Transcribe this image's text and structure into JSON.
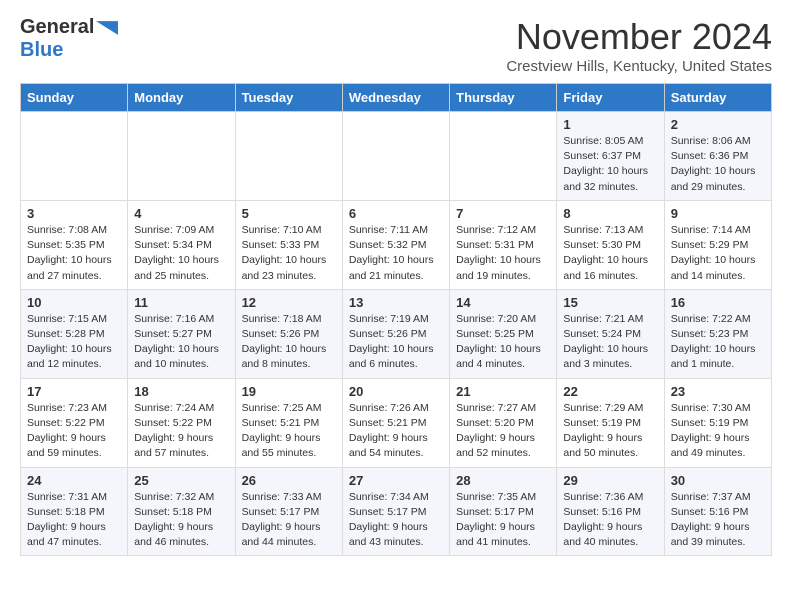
{
  "header": {
    "logo_line1": "General",
    "logo_line2": "Blue",
    "month": "November 2024",
    "location": "Crestview Hills, Kentucky, United States"
  },
  "weekdays": [
    "Sunday",
    "Monday",
    "Tuesday",
    "Wednesday",
    "Thursday",
    "Friday",
    "Saturday"
  ],
  "weeks": [
    [
      {
        "day": "",
        "info": ""
      },
      {
        "day": "",
        "info": ""
      },
      {
        "day": "",
        "info": ""
      },
      {
        "day": "",
        "info": ""
      },
      {
        "day": "",
        "info": ""
      },
      {
        "day": "1",
        "info": "Sunrise: 8:05 AM\nSunset: 6:37 PM\nDaylight: 10 hours\nand 32 minutes."
      },
      {
        "day": "2",
        "info": "Sunrise: 8:06 AM\nSunset: 6:36 PM\nDaylight: 10 hours\nand 29 minutes."
      }
    ],
    [
      {
        "day": "3",
        "info": "Sunrise: 7:08 AM\nSunset: 5:35 PM\nDaylight: 10 hours\nand 27 minutes."
      },
      {
        "day": "4",
        "info": "Sunrise: 7:09 AM\nSunset: 5:34 PM\nDaylight: 10 hours\nand 25 minutes."
      },
      {
        "day": "5",
        "info": "Sunrise: 7:10 AM\nSunset: 5:33 PM\nDaylight: 10 hours\nand 23 minutes."
      },
      {
        "day": "6",
        "info": "Sunrise: 7:11 AM\nSunset: 5:32 PM\nDaylight: 10 hours\nand 21 minutes."
      },
      {
        "day": "7",
        "info": "Sunrise: 7:12 AM\nSunset: 5:31 PM\nDaylight: 10 hours\nand 19 minutes."
      },
      {
        "day": "8",
        "info": "Sunrise: 7:13 AM\nSunset: 5:30 PM\nDaylight: 10 hours\nand 16 minutes."
      },
      {
        "day": "9",
        "info": "Sunrise: 7:14 AM\nSunset: 5:29 PM\nDaylight: 10 hours\nand 14 minutes."
      }
    ],
    [
      {
        "day": "10",
        "info": "Sunrise: 7:15 AM\nSunset: 5:28 PM\nDaylight: 10 hours\nand 12 minutes."
      },
      {
        "day": "11",
        "info": "Sunrise: 7:16 AM\nSunset: 5:27 PM\nDaylight: 10 hours\nand 10 minutes."
      },
      {
        "day": "12",
        "info": "Sunrise: 7:18 AM\nSunset: 5:26 PM\nDaylight: 10 hours\nand 8 minutes."
      },
      {
        "day": "13",
        "info": "Sunrise: 7:19 AM\nSunset: 5:26 PM\nDaylight: 10 hours\nand 6 minutes."
      },
      {
        "day": "14",
        "info": "Sunrise: 7:20 AM\nSunset: 5:25 PM\nDaylight: 10 hours\nand 4 minutes."
      },
      {
        "day": "15",
        "info": "Sunrise: 7:21 AM\nSunset: 5:24 PM\nDaylight: 10 hours\nand 3 minutes."
      },
      {
        "day": "16",
        "info": "Sunrise: 7:22 AM\nSunset: 5:23 PM\nDaylight: 10 hours\nand 1 minute."
      }
    ],
    [
      {
        "day": "17",
        "info": "Sunrise: 7:23 AM\nSunset: 5:22 PM\nDaylight: 9 hours\nand 59 minutes."
      },
      {
        "day": "18",
        "info": "Sunrise: 7:24 AM\nSunset: 5:22 PM\nDaylight: 9 hours\nand 57 minutes."
      },
      {
        "day": "19",
        "info": "Sunrise: 7:25 AM\nSunset: 5:21 PM\nDaylight: 9 hours\nand 55 minutes."
      },
      {
        "day": "20",
        "info": "Sunrise: 7:26 AM\nSunset: 5:21 PM\nDaylight: 9 hours\nand 54 minutes."
      },
      {
        "day": "21",
        "info": "Sunrise: 7:27 AM\nSunset: 5:20 PM\nDaylight: 9 hours\nand 52 minutes."
      },
      {
        "day": "22",
        "info": "Sunrise: 7:29 AM\nSunset: 5:19 PM\nDaylight: 9 hours\nand 50 minutes."
      },
      {
        "day": "23",
        "info": "Sunrise: 7:30 AM\nSunset: 5:19 PM\nDaylight: 9 hours\nand 49 minutes."
      }
    ],
    [
      {
        "day": "24",
        "info": "Sunrise: 7:31 AM\nSunset: 5:18 PM\nDaylight: 9 hours\nand 47 minutes."
      },
      {
        "day": "25",
        "info": "Sunrise: 7:32 AM\nSunset: 5:18 PM\nDaylight: 9 hours\nand 46 minutes."
      },
      {
        "day": "26",
        "info": "Sunrise: 7:33 AM\nSunset: 5:17 PM\nDaylight: 9 hours\nand 44 minutes."
      },
      {
        "day": "27",
        "info": "Sunrise: 7:34 AM\nSunset: 5:17 PM\nDaylight: 9 hours\nand 43 minutes."
      },
      {
        "day": "28",
        "info": "Sunrise: 7:35 AM\nSunset: 5:17 PM\nDaylight: 9 hours\nand 41 minutes."
      },
      {
        "day": "29",
        "info": "Sunrise: 7:36 AM\nSunset: 5:16 PM\nDaylight: 9 hours\nand 40 minutes."
      },
      {
        "day": "30",
        "info": "Sunrise: 7:37 AM\nSunset: 5:16 PM\nDaylight: 9 hours\nand 39 minutes."
      }
    ]
  ]
}
